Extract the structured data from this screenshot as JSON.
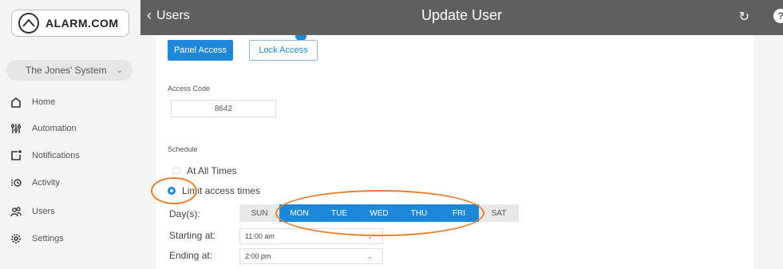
{
  "sidebar": {
    "logo_text": "ALARM.COM",
    "system_name": "The Jones' System",
    "items": [
      {
        "label": "Home",
        "icon": "home-icon"
      },
      {
        "label": "Automation",
        "icon": "sliders-icon"
      },
      {
        "label": "Notifications",
        "icon": "notification-icon"
      },
      {
        "label": "Activity",
        "icon": "activity-icon"
      },
      {
        "label": "Users",
        "icon": "users-icon"
      },
      {
        "label": "Settings",
        "icon": "gear-icon"
      }
    ]
  },
  "header": {
    "back_label": "Users",
    "title": "Update User"
  },
  "tabs": {
    "panel_access": "Panel Access",
    "lock_access": "Lock Access"
  },
  "access_code": {
    "label": "Access Code",
    "value": "8642"
  },
  "schedule": {
    "label": "Schedule",
    "option_all": "At All Times",
    "option_limit": "Limit access times",
    "selected": "option_limit",
    "days_label": "Day(s):",
    "days": [
      {
        "label": "SUN",
        "selected": false
      },
      {
        "label": "MON",
        "selected": true
      },
      {
        "label": "TUE",
        "selected": true
      },
      {
        "label": "WED",
        "selected": true
      },
      {
        "label": "THU",
        "selected": true
      },
      {
        "label": "FRI",
        "selected": true
      },
      {
        "label": "SAT",
        "selected": false
      }
    ],
    "start_label": "Starting at:",
    "start_value": "11:00 am",
    "end_label": "Ending at:",
    "end_value": "2:00 pm"
  },
  "colors": {
    "accent": "#1e88d8",
    "header": "#5f5f5f",
    "annotation": "#e87e2c"
  }
}
